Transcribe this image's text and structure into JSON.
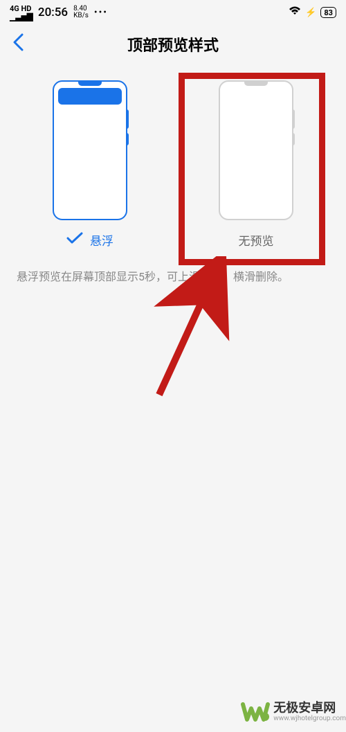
{
  "status_bar": {
    "network_type": "4G HD",
    "time": "20:56",
    "speed": "8.40",
    "speed_unit": "KB/s",
    "dots": "•••",
    "battery_pct": "83"
  },
  "nav": {
    "title": "顶部预览样式"
  },
  "options": {
    "floating": {
      "label": "悬浮"
    },
    "none": {
      "label": "无预览"
    }
  },
  "description": "悬浮预览在屏幕顶部显示5秒，可上滑收起、横滑删除。",
  "watermark": {
    "name": "无极安卓网",
    "url": "www.wjhotelgroup.com"
  },
  "annotation": {
    "highlight_color": "#c21b17"
  }
}
